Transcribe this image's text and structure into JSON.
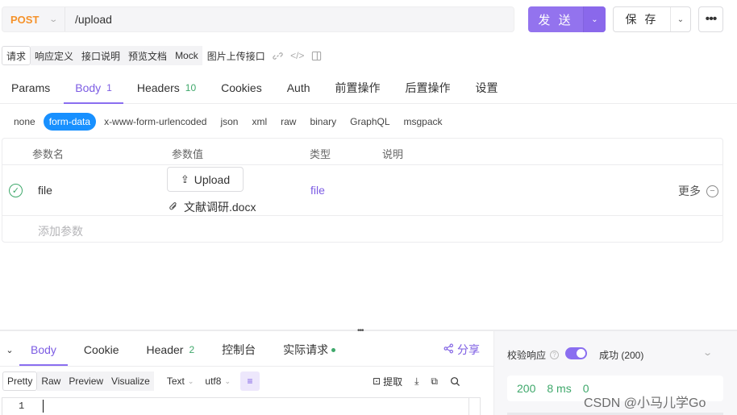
{
  "url_bar": {
    "method": "POST",
    "url": "/upload",
    "send_label": "发 送",
    "save_label": "保 存",
    "more_label": "•••"
  },
  "segment_tabs": {
    "items": [
      "请求",
      "响应定义",
      "接口说明",
      "预览文档",
      "Mock"
    ],
    "active": "请求",
    "api_name": "图片上传接口"
  },
  "main_tabs": [
    {
      "label": "Params",
      "badge": ""
    },
    {
      "label": "Body",
      "badge": "1"
    },
    {
      "label": "Headers",
      "badge": "10"
    },
    {
      "label": "Cookies",
      "badge": ""
    },
    {
      "label": "Auth",
      "badge": ""
    },
    {
      "label": "前置操作",
      "badge": ""
    },
    {
      "label": "后置操作",
      "badge": ""
    },
    {
      "label": "设置",
      "badge": ""
    }
  ],
  "body_types": [
    "none",
    "form-data",
    "x-www-form-urlencoded",
    "json",
    "xml",
    "raw",
    "binary",
    "GraphQL",
    "msgpack"
  ],
  "params_table": {
    "headers": [
      "参数名",
      "参数值",
      "类型",
      "说明"
    ],
    "row": {
      "name": "file",
      "upload_label": "Upload",
      "file_name": "文献调研.docx",
      "type": "file",
      "more_label": "更多"
    },
    "add_placeholder": "添加参数"
  },
  "response_tabs": [
    {
      "label": "Body",
      "badge": ""
    },
    {
      "label": "Cookie",
      "badge": ""
    },
    {
      "label": "Header",
      "badge": "2"
    },
    {
      "label": "控制台",
      "badge": ""
    },
    {
      "label": "实际请求",
      "badge": ""
    }
  ],
  "share_label": "分享",
  "format_tabs": [
    "Pretty",
    "Raw",
    "Preview",
    "Visualize"
  ],
  "format_selects": {
    "type": "Text",
    "encoding": "utf8"
  },
  "extract_label": "提取",
  "editor": {
    "line_number": "1"
  },
  "validation": {
    "label": "校验响应",
    "status": "成功 (200)",
    "status_code": "200",
    "time": "8 ms",
    "size": "0"
  },
  "watermark": "CSDN @小马儿学Go",
  "colors": {
    "accent": "#8a6ef0",
    "method": "#f5922a",
    "success": "#3fa86b",
    "link_blue": "#1890ff"
  }
}
